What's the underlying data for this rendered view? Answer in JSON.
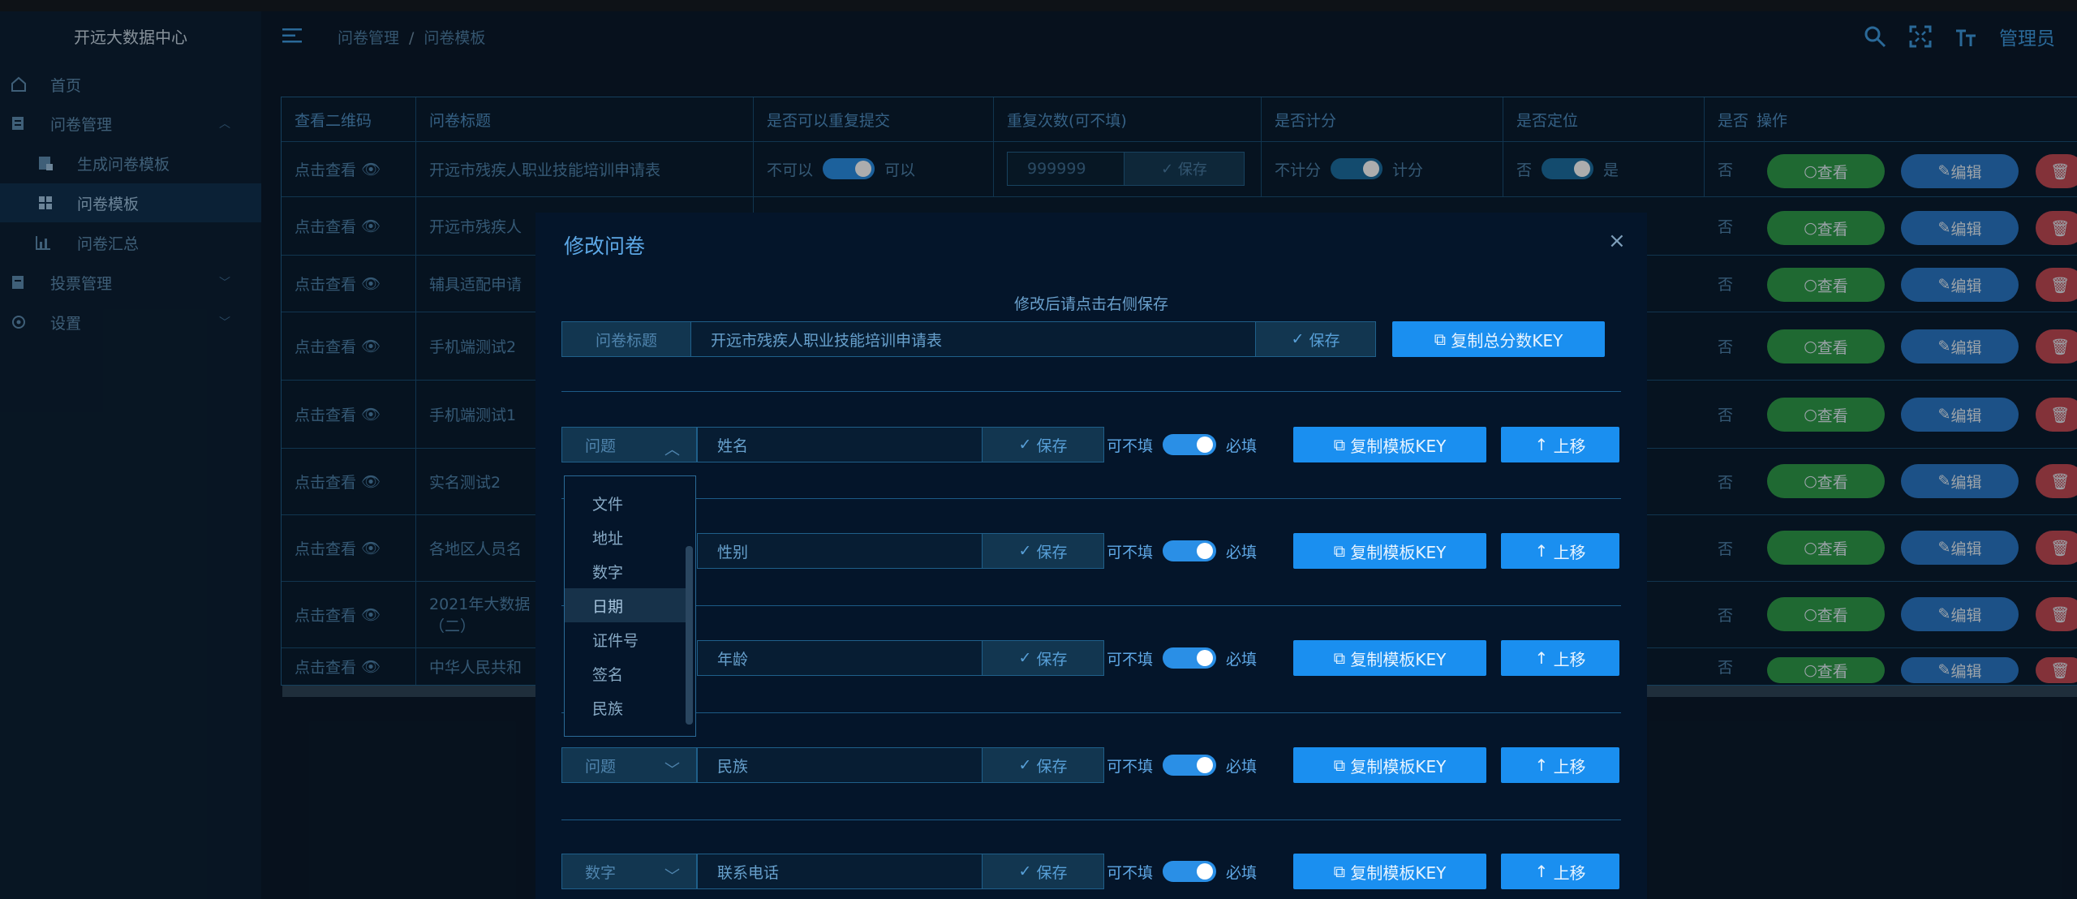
{
  "app": {
    "logo": "开远大数据中心",
    "admin": "管理员"
  },
  "sidebar": {
    "items": [
      {
        "label": "首页",
        "icon": "home-icon"
      },
      {
        "label": "问卷管理",
        "icon": "survey-icon",
        "expanded": true
      },
      {
        "label": "生成问卷模板",
        "icon": "template-gen-icon"
      },
      {
        "label": "问卷模板",
        "icon": "grid-icon",
        "active": true
      },
      {
        "label": "问卷汇总",
        "icon": "bar-chart-icon"
      },
      {
        "label": "投票管理",
        "icon": "vote-icon"
      },
      {
        "label": "设置",
        "icon": "gear-icon"
      }
    ]
  },
  "breadcrumb": {
    "level1": "问卷管理",
    "sep": "/",
    "level2": "问卷模板"
  },
  "table": {
    "headers": [
      "查看二维码",
      "问卷标题",
      "是否可以重复提交",
      "重复次数(可不填)",
      "是否计分",
      "是否定位",
      "是否",
      "操作"
    ],
    "rows": [
      {
        "qr": "点击查看",
        "title": "开远市残疾人职业技能培训申请表"
      },
      {
        "qr": "点击查看",
        "title": "开远市残疾人"
      },
      {
        "qr": "点击查看",
        "title": "辅具适配申请"
      },
      {
        "qr": "点击查看",
        "title": "手机端测试2"
      },
      {
        "qr": "点击查看",
        "title": "手机端测试1"
      },
      {
        "qr": "点击查看",
        "title": "实名测试2"
      },
      {
        "qr": "点击查看",
        "title": "各地区人员名"
      },
      {
        "qr": "点击查看",
        "title": "2021年大数据",
        "title2": "（二）"
      },
      {
        "qr": "点击查看",
        "title": "中华人民共和"
      }
    ],
    "repeat_no": "不可以",
    "repeat_yes": "可以",
    "repeat_count": "999999",
    "save": "保存",
    "score_no": "不计分",
    "score_yes": "计分",
    "loc_no": "否",
    "loc_yes": "是",
    "misc_no": "否",
    "view": "查看",
    "edit": "编辑"
  },
  "modal": {
    "title": "修改问卷",
    "hint": "修改后请点击右侧保存",
    "title_label": "问卷标题",
    "title_value": "开远市残疾人职业技能培训申请表",
    "save": "保存",
    "copy_total_key": "复制总分数KEY",
    "optional": "可不填",
    "required": "必填",
    "copy_template_key": "复制模板KEY",
    "move_up": "上移",
    "questions": [
      {
        "type": "问题",
        "value": "姓名",
        "open": true
      },
      {
        "type": "",
        "value": "性别"
      },
      {
        "type": "",
        "value": "年龄"
      },
      {
        "type": "问题",
        "value": "民族"
      },
      {
        "type": "数字",
        "value": "联系电话"
      }
    ],
    "dropdown": {
      "options": [
        "文件",
        "地址",
        "数字",
        "日期",
        "证件号",
        "签名",
        "民族"
      ],
      "highlighted": "日期"
    }
  }
}
